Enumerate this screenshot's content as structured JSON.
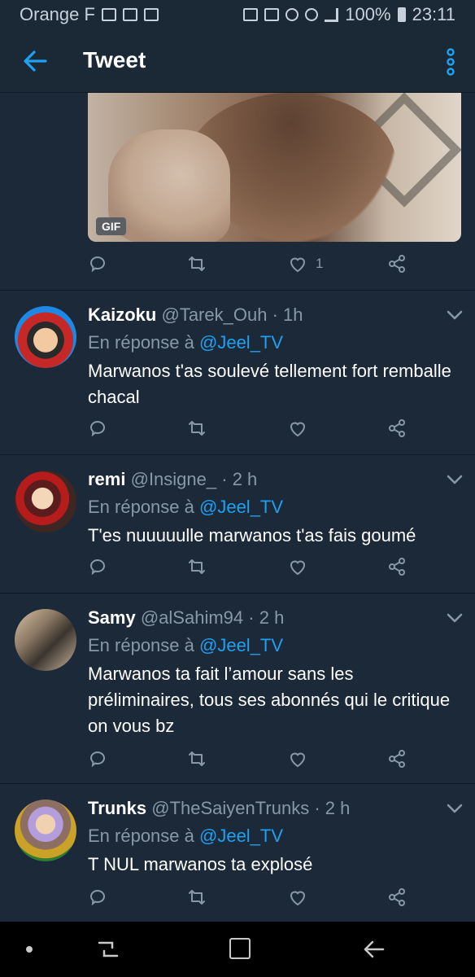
{
  "status_bar": {
    "carrier": "Orange F",
    "battery": "100%",
    "time": "23:11"
  },
  "app_bar": {
    "title": "Tweet"
  },
  "media_tweet": {
    "media_badge": "GIF",
    "like_count": "1"
  },
  "reply_prefix": "En réponse à",
  "replies": [
    {
      "name": "Kaizoku",
      "handle": "@Tarek_Ouh",
      "time": "1h",
      "reply_to": "@Jeel_TV",
      "text": "Marwanos t'as soulevé tellement fort remballe chacal"
    },
    {
      "name": "remi",
      "handle": "@Insigne_",
      "time": "2 h",
      "reply_to": "@Jeel_TV",
      "text": "T'es nuuuuulle marwanos t'as fais goumé"
    },
    {
      "name": "Samy",
      "handle": "@alSahim94",
      "time": "2 h",
      "reply_to": "@Jeel_TV",
      "text": "Marwanos ta fait l’amour sans les préliminaires, tous ses abonnés qui le critique on vous bz"
    },
    {
      "name": "Trunks",
      "handle": "@TheSaiyenTrunks",
      "time": "2 h",
      "reply_to": "@Jeel_TV",
      "text": "T NUL marwanos ta explosé"
    }
  ],
  "colors": {
    "background": "#1c2938",
    "accent": "#1da1f2",
    "muted": "#8899a6"
  }
}
